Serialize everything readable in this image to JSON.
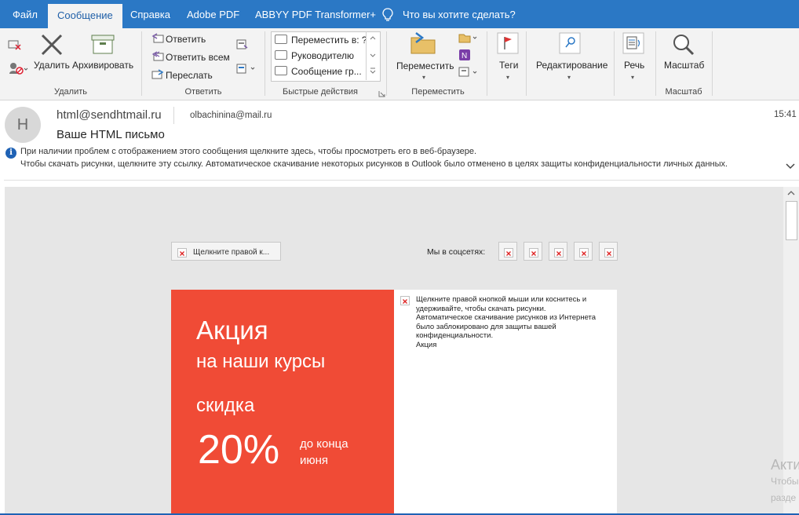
{
  "ribbon_tabs": [
    "Файл",
    "Сообщение",
    "Справка",
    "Adobe PDF",
    "ABBYY PDF Transformer+"
  ],
  "active_tab": "Сообщение",
  "tell_me": "Что вы хотите сделать?",
  "ribbon": {
    "delete_group": {
      "label": "Удалить",
      "delete": "Удалить",
      "archive": "Архивировать"
    },
    "respond_group": {
      "label": "Ответить",
      "reply": "Ответить",
      "reply_all": "Ответить всем",
      "forward": "Переслать"
    },
    "quick_steps": {
      "label": "Быстрые действия",
      "items": [
        "Переместить в: ?",
        "Руководителю",
        "Сообщение гр..."
      ]
    },
    "move_group": {
      "label": "Переместить",
      "move": "Переместить"
    },
    "tags": "Теги",
    "editing": "Редактирование",
    "speech": "Речь",
    "zoom_group": {
      "label": "Масштаб",
      "zoom": "Масштаб"
    }
  },
  "message": {
    "avatar_initial": "H",
    "from": "html@sendhtmail.ru",
    "to": "olbachinina@mail.ru",
    "subject": "Ваше HTML письмо",
    "time": "15:41",
    "info_line1": "При наличии проблем с отображением этого сообщения щелкните здесь, чтобы просмотреть его в веб-браузере.",
    "info_line2": "Чтобы скачать рисунки, щелкните эту ссылку. Автоматическое скачивание некоторых рисунков в Outlook было отменено в целях защиты конфиденциальности личных данных."
  },
  "body": {
    "top_placeholder": "Щелкните правой к...",
    "social_label": "Мы в соцсетях:",
    "social_icons_count": 5,
    "promo": {
      "title": "Акция",
      "line2": "на наши курсы",
      "line3": "скидка",
      "percent": "20%",
      "until_line1": "до конца",
      "until_line2": "июня"
    },
    "blocked_image_text": "Щелкните правой кнопкой мыши или коснитесь и удерживайте, чтобы скачать рисунки.\nАвтоматическое скачивание рисунков из Интернета было заблокировано для защиты вашей конфиденциальности.\nАкция"
  },
  "watermark": {
    "line1": "Акти",
    "line2": "Чтобы",
    "line3": "разде"
  },
  "colors": {
    "ribbon_blue": "#2b78c5",
    "promo_red": "#f04b36",
    "info_blue": "#1f62b5"
  }
}
